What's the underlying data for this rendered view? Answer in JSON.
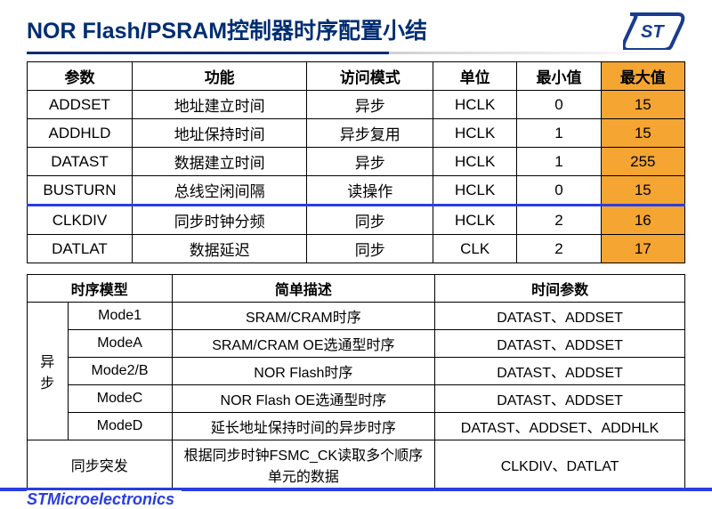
{
  "title": "NOR Flash/PSRAM控制器时序配置小结",
  "footer_brand": "STMicroelectronics",
  "table1": {
    "headers": [
      "参数",
      "功能",
      "访问模式",
      "单位",
      "最小值",
      "最大值"
    ],
    "rows": [
      {
        "p": "ADDSET",
        "f": "地址建立时间",
        "m": "异步",
        "u": "HCLK",
        "min": "0",
        "max": "15"
      },
      {
        "p": "ADDHLD",
        "f": "地址保持时间",
        "m": "异步复用",
        "u": "HCLK",
        "min": "1",
        "max": "15"
      },
      {
        "p": "DATAST",
        "f": "数据建立时间",
        "m": "异步",
        "u": "HCLK",
        "min": "1",
        "max": "255"
      },
      {
        "p": "BUSTURN",
        "f": "总线空闲间隔",
        "m": "读操作",
        "u": "HCLK",
        "min": "0",
        "max": "15"
      },
      {
        "p": "CLKDIV",
        "f": "同步时钟分频",
        "m": "同步",
        "u": "HCLK",
        "min": "2",
        "max": "16"
      },
      {
        "p": "DATLAT",
        "f": "数据延迟",
        "m": "同步",
        "u": "CLK",
        "min": "2",
        "max": "17"
      }
    ]
  },
  "table2": {
    "headers": [
      "时序模型",
      "简单描述",
      "时间参数"
    ],
    "rowgroup_label": "异步",
    "rows": [
      {
        "mode": "Mode1",
        "desc": "SRAM/CRAM时序",
        "params": "DATAST、ADDSET"
      },
      {
        "mode": "ModeA",
        "desc": "SRAM/CRAM OE选通型时序",
        "params": "DATAST、ADDSET"
      },
      {
        "mode": "Mode2/B",
        "desc": "NOR Flash时序",
        "params": "DATAST、ADDSET"
      },
      {
        "mode": "ModeC",
        "desc": "NOR Flash OE选通型时序",
        "params": "DATAST、ADDSET"
      },
      {
        "mode": "ModeD",
        "desc": "延长地址保持时间的异步时序",
        "params": "DATAST、ADDSET、ADDHLK"
      }
    ],
    "sync_row": {
      "mode": "同步突发",
      "desc": "根据同步时钟FSMC_CK读取多个顺序单元的数据",
      "params": "CLKDIV、DATLAT"
    }
  }
}
